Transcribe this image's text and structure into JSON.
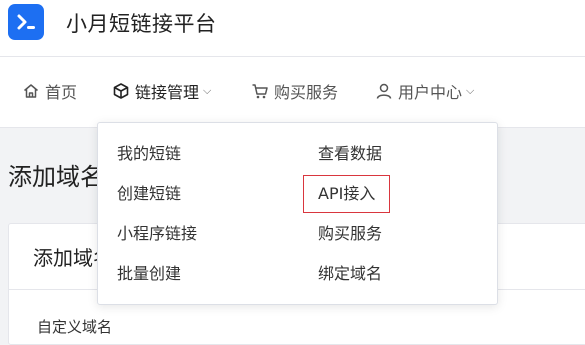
{
  "app": {
    "title": "小月短链接平台"
  },
  "nav": {
    "items": [
      {
        "label": "首页",
        "icon": "home-icon"
      },
      {
        "label": "链接管理",
        "icon": "cube-icon",
        "has_dropdown": true
      },
      {
        "label": "购买服务",
        "icon": "cart-icon"
      },
      {
        "label": "用户中心",
        "icon": "user-icon",
        "has_dropdown": true
      }
    ]
  },
  "dropdown": {
    "left_column": [
      "我的短链",
      "创建短链",
      "小程序链接",
      "批量创建"
    ],
    "right_column": [
      "查看数据",
      "API接入",
      "购买服务",
      "绑定域名"
    ],
    "highlighted": "API接入"
  },
  "page": {
    "title": "添加域名",
    "card_title": "添加域名",
    "card_subtitle": "自定义域名"
  },
  "colors": {
    "brand": "#1d6ff2",
    "highlight_border": "#d9363e"
  }
}
